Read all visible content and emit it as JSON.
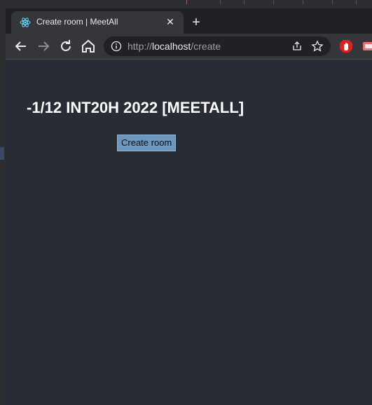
{
  "browser": {
    "tab": {
      "title": "Create room | MeetAll",
      "favicon": "react-atom-icon"
    },
    "url": {
      "scheme": "http://",
      "host": "localhost",
      "path": "/create"
    }
  },
  "page": {
    "heading": "-1/12 INT20H 2022 [MEETALL]",
    "create_button_label": "Create room"
  },
  "colors": {
    "page_bg": "#282c34",
    "button_bg": "#6b97bf",
    "accent_react": "#61dafb"
  }
}
